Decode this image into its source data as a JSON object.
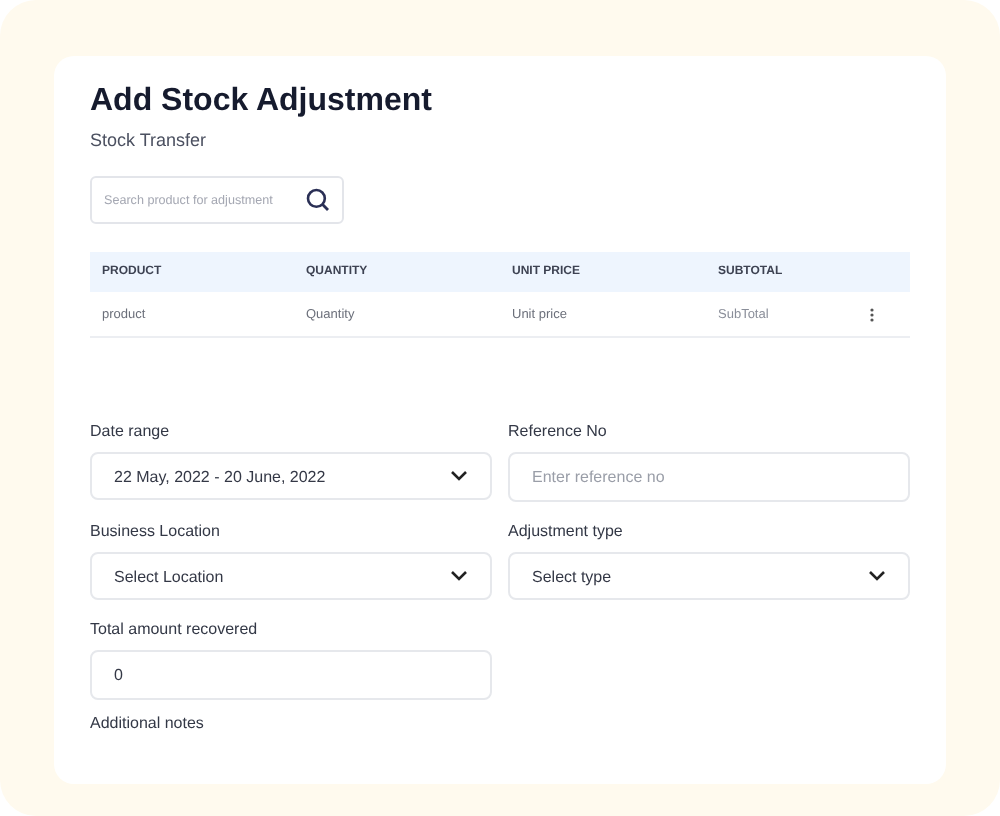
{
  "title": "Add Stock Adjustment",
  "subtitle": "Stock Transfer",
  "search": {
    "placeholder": "Search product for adjustment"
  },
  "table": {
    "columns": [
      "PRODUCT",
      "QUANTITY",
      "UNIT PRICE",
      "SUBTOTAL"
    ],
    "rows": [
      {
        "cells": [
          "product",
          "Quantity",
          "Unit price",
          "SubTotal"
        ]
      }
    ]
  },
  "fields": [
    {
      "label": "Date range",
      "kind": "select",
      "value": "22 May, 2022 - 20 June, 2022"
    },
    {
      "label": "Reference No",
      "kind": "input",
      "placeholder": "Enter reference no"
    },
    {
      "label": "Business Location",
      "kind": "select",
      "value": "Select Location"
    },
    {
      "label": "Adjustment type",
      "kind": "select",
      "value": "Select type"
    },
    {
      "label": "Total amount recovered",
      "kind": "input",
      "value": "0"
    }
  ],
  "notes": {
    "label": "Additional notes"
  }
}
